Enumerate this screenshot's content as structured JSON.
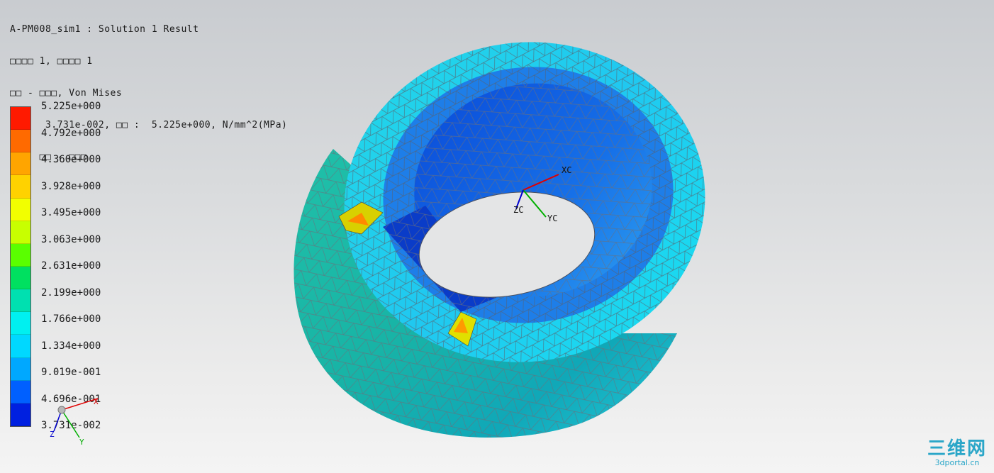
{
  "header": {
    "lines": [
      "A-PM008_sim1 : Solution 1 Result",
      "□□□□ 1, □□□□ 1",
      "□□ - □□□, Von Mises",
      "□□ :  3.731e-002, □□ :  5.225e+000, N/mm^2(MPa)",
      "□□ : □□ - □□□"
    ]
  },
  "legend": {
    "labels": [
      "5.225e+000",
      "4.792e+000",
      "4.360e+000",
      "3.928e+000",
      "3.495e+000",
      "3.063e+000",
      "2.631e+000",
      "2.199e+000",
      "1.766e+000",
      "1.334e+000",
      "9.019e-001",
      "4.696e-001",
      "3.731e-002"
    ],
    "colors": [
      "#ff1a00",
      "#ff6a00",
      "#ffa500",
      "#ffd200",
      "#f2ff00",
      "#c8ff00",
      "#5aff00",
      "#00e060",
      "#00e0b0",
      "#00f0f0",
      "#00d8ff",
      "#00a8ff",
      "#0060ff",
      "#0020e0"
    ]
  },
  "triad_legend": {
    "x": "X",
    "y": "Y",
    "z": "Z"
  },
  "triad_model": {
    "x": "XC",
    "y": "YC",
    "z": "ZC"
  },
  "watermark": {
    "brand": "三维网",
    "site": "3dportal.cn"
  }
}
